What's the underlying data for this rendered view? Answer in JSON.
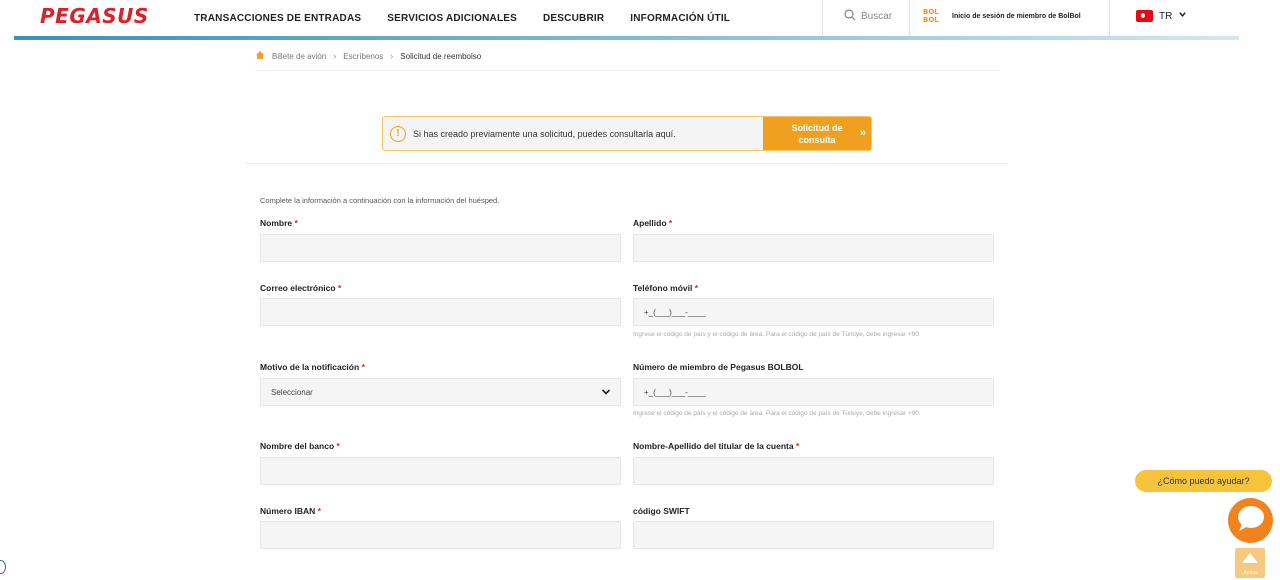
{
  "header": {
    "logo_text": "PEGASUS",
    "nav": [
      "TRANSACCIONES DE ENTRADAS",
      "SERVICIOS ADICIONALES",
      "DESCUBRIR",
      "INFORMACIÓN ÚTIL"
    ],
    "search_label": "Buscar",
    "bolbol_logo": [
      "BOL",
      "BOL"
    ],
    "bolbol_login": "Inicio de sesión de miembro de BolBol",
    "language": "TR"
  },
  "breadcrumb": [
    "Billete de avión",
    "Escríbenos",
    "Solicitud de reembolso"
  ],
  "banner": {
    "text": "Si has creado previamente una solicitud, puedes consultarla aquí.",
    "button_line1": "Solicitud de",
    "button_line2": "consulta"
  },
  "form": {
    "intro": "Complete la información a continuación con la información del huésped.",
    "required_mark": "*",
    "first_name_label": "Nombre",
    "last_name_label": "Apellido",
    "email_label": "Correo electrónico",
    "mobile_label": "Teléfono móvil",
    "mobile_value": "+_(___)___-____",
    "mobile_hint": "Ingrese el código de país y el código de área. Para el código de país de Türkiye, debe ingresar +90.",
    "reason_label": "Motivo de la notificación",
    "reason_value": "Seleccionar",
    "bolbol_label": "Número de miembro de Pegasus BOLBOL",
    "bolbol_value": "+_(___)___-____",
    "bolbol_hint": "Ingrese el código de país y el código de área. Para el código de país de Türkiye, debe ingresar +90.",
    "bank_label": "Nombre del banco",
    "holder_label": "Nombre-Apellido del titular de la cuenta",
    "iban_label": "Número IBAN",
    "swift_label": "código SWIFT"
  },
  "chat": {
    "help_text": "¿Cómo puedo ayudar?",
    "scroll_top_label": "Arriba"
  },
  "colors": {
    "brand_red": "#d9222a",
    "accent_orange": "#f0a01e",
    "header_bar": "#3d8fb5"
  }
}
